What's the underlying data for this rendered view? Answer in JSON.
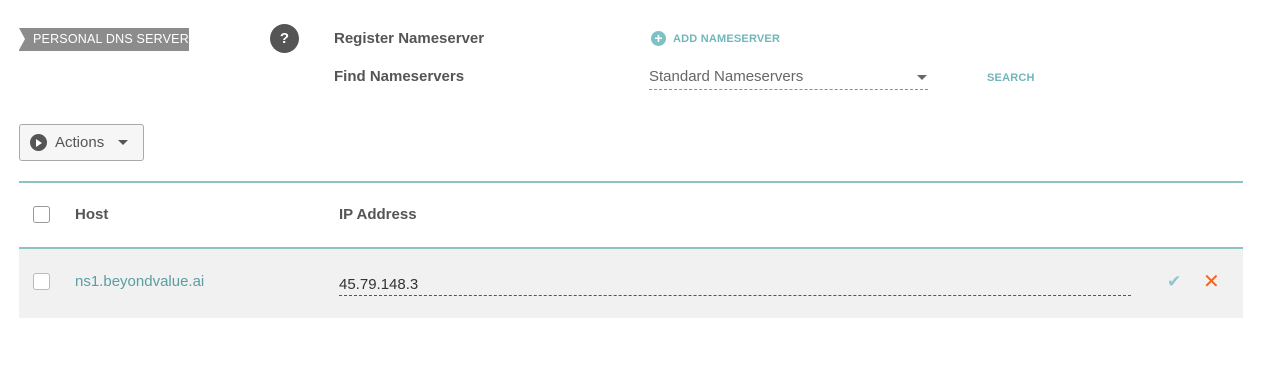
{
  "section": {
    "tag": "PERSONAL DNS SERVER",
    "help": "?"
  },
  "register": {
    "label": "Register Nameserver",
    "add_icon": "plus-circle-icon",
    "add_label": "ADD NAMESERVER"
  },
  "find": {
    "label": "Find Nameservers",
    "select_value": "Standard Nameservers",
    "search_label": "SEARCH"
  },
  "toolbar": {
    "actions_label": "Actions"
  },
  "table": {
    "columns": [
      "Host",
      "IP Address"
    ],
    "rows": [
      {
        "host": "ns1.beyondvalue.ai",
        "ip": "45.79.148.3",
        "confirm_icon": "check-icon",
        "remove_icon": "close-icon"
      }
    ]
  },
  "colors": {
    "accent": "#6fb7bb",
    "remove": "#f26522",
    "rule": "#8cc3c4",
    "row_bg": "#f1f1f1"
  }
}
